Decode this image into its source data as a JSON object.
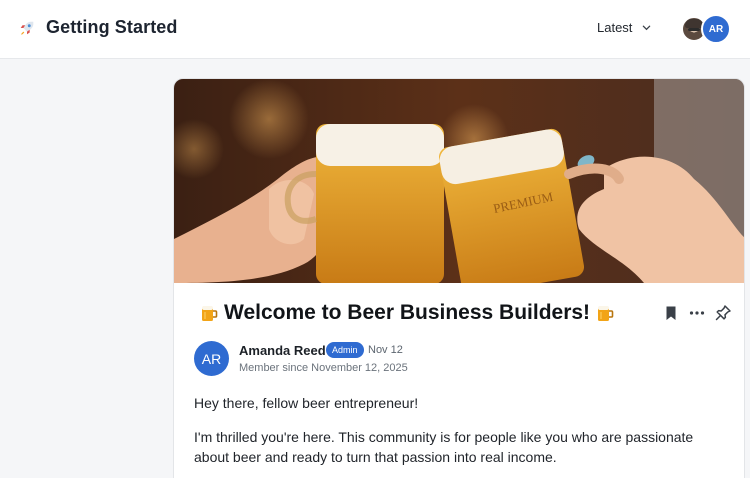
{
  "header": {
    "title": "Getting Started",
    "title_icon": "rocket-icon",
    "sort_label": "Latest",
    "user_initials": "AR"
  },
  "post": {
    "title": "Welcome to Beer Business Builders!",
    "title_icon": "beer-mug-icon",
    "author": {
      "initials": "AR",
      "name": "Amanda Reed",
      "role_badge": "Admin",
      "date": "Nov 12",
      "member_since": "Member since November 12, 2025"
    },
    "paragraphs": [
      "Hey there, fellow beer entrepreneur!",
      "I'm thrilled you're here. This community is for people like you who are passionate about beer and ready to turn that passion into real income."
    ]
  },
  "colors": {
    "accent": "#2f6bd1",
    "background": "#f5f6f8",
    "card": "#ffffff"
  }
}
